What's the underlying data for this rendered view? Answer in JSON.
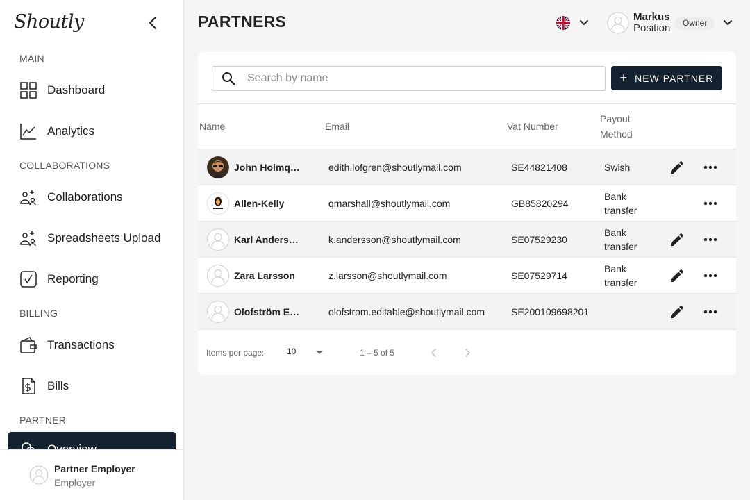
{
  "app": {
    "logo_text": "Shoutly"
  },
  "sidebar": {
    "sections": [
      "MAIN",
      "COLLABORATIONS",
      "BILLING",
      "PARTNER"
    ],
    "items": [
      {
        "label": "Dashboard",
        "icon": "dashboard-grid-icon"
      },
      {
        "label": "Analytics",
        "icon": "analytics-chart-icon"
      },
      {
        "label": "Collaborations",
        "icon": "collaborations-icon"
      },
      {
        "label": "Spreadsheets Upload",
        "icon": "spreadsheet-upload-icon"
      },
      {
        "label": "Reporting",
        "icon": "reporting-check-icon"
      },
      {
        "label": "Transactions",
        "icon": "wallet-icon"
      },
      {
        "label": "Bills",
        "icon": "bill-icon"
      },
      {
        "label": "Overview",
        "icon": "overview-icon"
      }
    ],
    "footer": {
      "name": "Partner Employer",
      "role": "Employer"
    }
  },
  "header": {
    "title": "PARTNERS",
    "language_flag": "uk-flag-icon",
    "user": {
      "name": "Markus",
      "position": "Position",
      "role_badge": "Owner"
    }
  },
  "toolbar": {
    "search_placeholder": "Search by name",
    "new_partner_label": "NEW PARTNER"
  },
  "table": {
    "columns": {
      "name": "Name",
      "email": "Email",
      "vat": "Vat Number",
      "payout_line1": "Payout",
      "payout_line2": "Method"
    },
    "rows": [
      {
        "name": "John Holmqvist",
        "email": "edith.lofgren@shoutlymail.com",
        "vat": "SE44821408",
        "payout": "Swish",
        "avatar": "photo",
        "editable": true
      },
      {
        "name": "Allen-Kelly",
        "email": "qmarshall@shoutlymail.com",
        "vat": "GB85820294",
        "payout": "Bank transfer",
        "avatar": "logo",
        "editable": false
      },
      {
        "name": "Karl Andersson",
        "email": "k.andersson@shoutlymail.com",
        "vat": "SE07529230",
        "payout": "Bank transfer",
        "avatar": "placeholder",
        "editable": true
      },
      {
        "name": "Zara Larsson",
        "email": "z.larsson@shoutlymail.com",
        "vat": "SE07529714",
        "payout": "Bank transfer",
        "avatar": "placeholder",
        "editable": true
      },
      {
        "name": "Olofström Editable",
        "email": "olofstrom.editable@shoutlymail.com",
        "vat": "SE200109698201",
        "payout": "",
        "avatar": "placeholder",
        "editable": true
      }
    ]
  },
  "pagination": {
    "items_per_page_label": "Items per page:",
    "items_per_page": "10",
    "range": "1 – 5 of 5"
  },
  "colors": {
    "primary": "#14222f",
    "row_shade": "#f3f3f3",
    "background": "#f5f5f5"
  }
}
